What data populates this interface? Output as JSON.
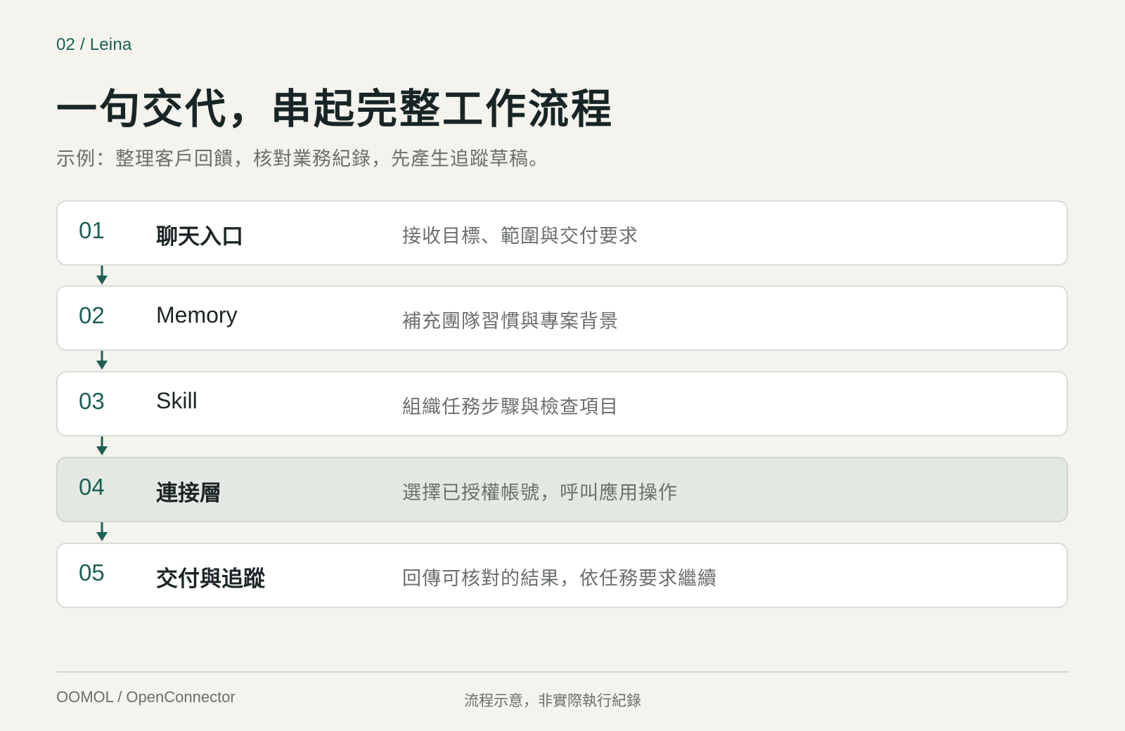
{
  "header": {
    "eyebrow": "02 / Leina",
    "title": "一句交代，串起完整工作流程",
    "subtitle": "示例：整理客戶回饋，核對業務紀錄，先產生追蹤草稿。"
  },
  "steps": [
    {
      "number": "01",
      "name": "聊天入口",
      "description": "接收目標、範圍與交付要求"
    },
    {
      "number": "02",
      "name": "Memory",
      "description": "補充團隊習慣與專案背景"
    },
    {
      "number": "03",
      "name": "Skill",
      "description": "組織任務步驟與檢查項目"
    },
    {
      "number": "04",
      "name": "連接層",
      "description": "選擇已授權帳號，呼叫應用操作"
    },
    {
      "number": "05",
      "name": "交付與追蹤",
      "description": "回傳可核對的結果，依任務要求繼續"
    }
  ],
  "highlighted_step": "04",
  "footer": {
    "brand": "OOMOL / OpenConnector",
    "note": "流程示意，非實際執行紀錄"
  },
  "colors": {
    "accent": "#1d5f55",
    "background": "#f4f3ed",
    "card": "#ffffff",
    "highlight_card": "#e4e8e3"
  }
}
